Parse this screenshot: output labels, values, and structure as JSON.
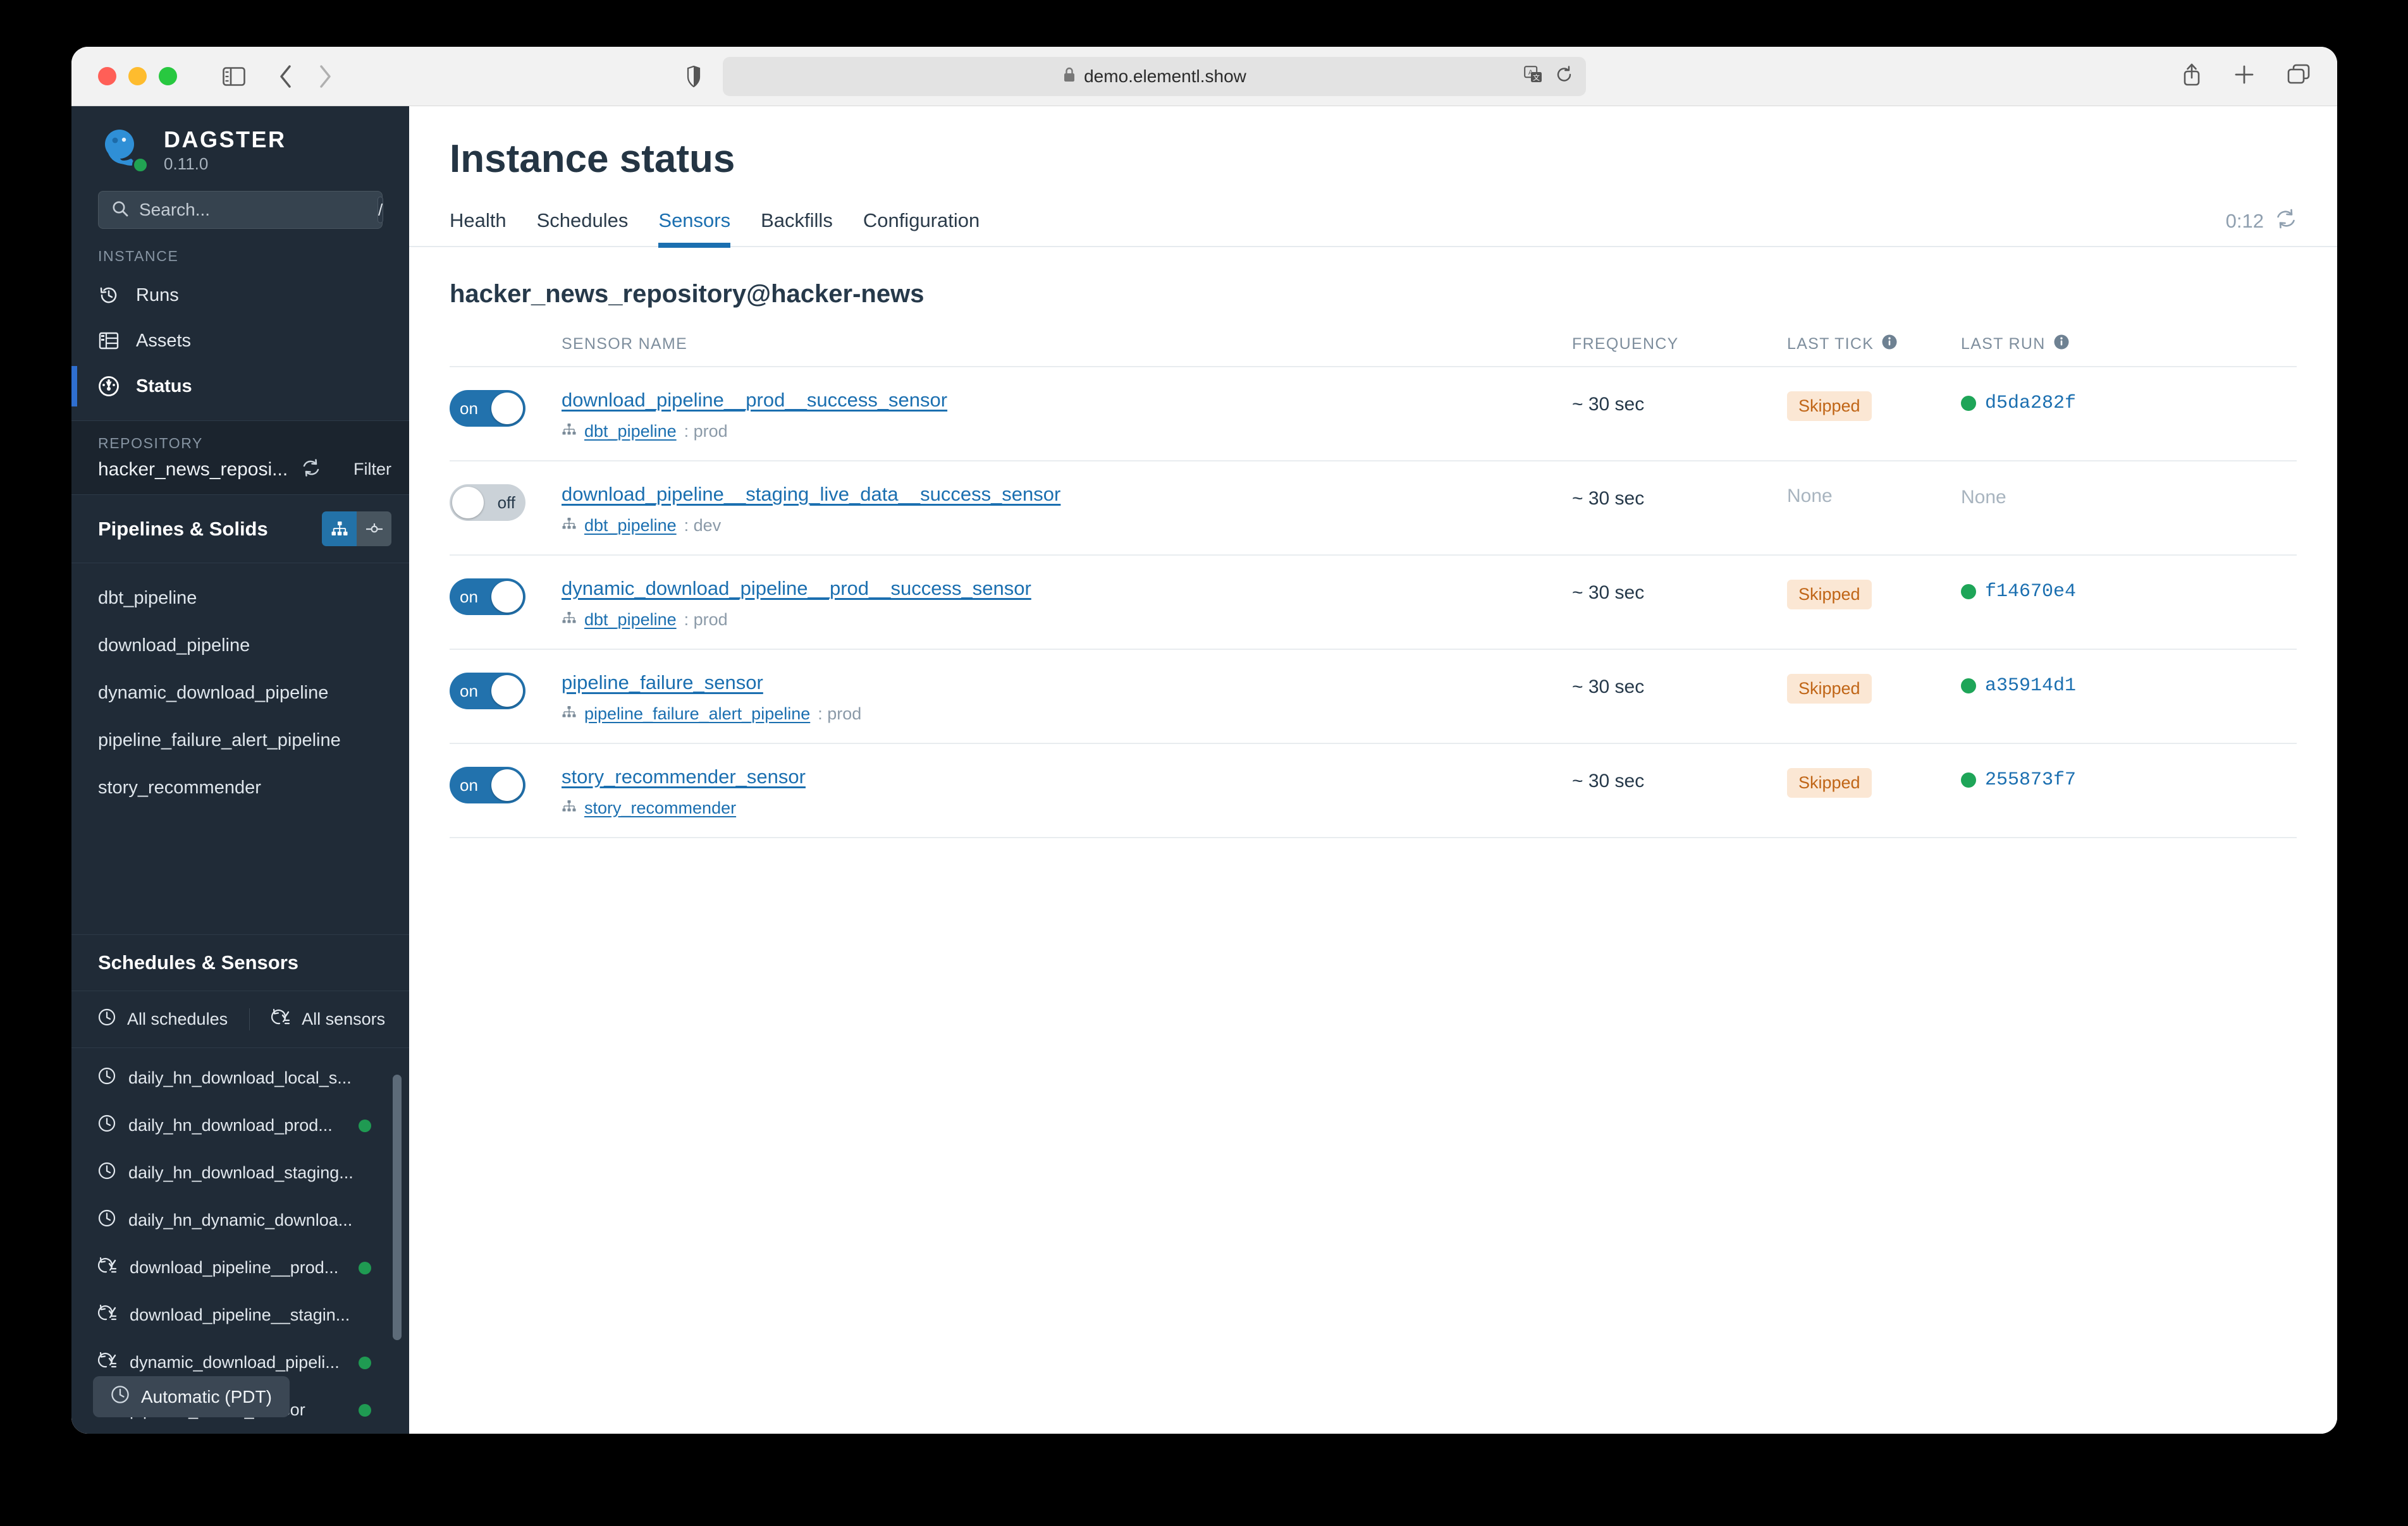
{
  "browser": {
    "url": "demo.elementl.show",
    "icons": {
      "sidebar_toggle": "sidebar-toggle-icon",
      "back": "chevron-left-icon",
      "forward": "chevron-right-icon",
      "shield": "shield-icon",
      "lock": "lock-icon",
      "translate": "translate-icon",
      "reload": "reload-icon",
      "share": "share-icon",
      "new_tab": "plus-icon",
      "tab_overview": "tab-overview-icon"
    }
  },
  "sidebar": {
    "brand": {
      "name": "DAGSTER",
      "version": "0.11.0"
    },
    "search": {
      "value": "",
      "placeholder": "Search...",
      "shortcut": "/"
    },
    "instance_label": "INSTANCE",
    "instance_items": [
      {
        "label": "Runs",
        "icon": "history-icon",
        "active": false
      },
      {
        "label": "Assets",
        "icon": "table-icon",
        "active": false
      },
      {
        "label": "Status",
        "icon": "gauge-icon",
        "active": true
      }
    ],
    "repository": {
      "label": "REPOSITORY",
      "name": "hacker_news_reposi...",
      "reload_icon": "reload-icon",
      "filter_label": "Filter"
    },
    "pipelines": {
      "title": "Pipelines & Solids",
      "view_graph_icon": "hierarchy-icon",
      "view_solid_icon": "node-icon",
      "items": [
        "dbt_pipeline",
        "download_pipeline",
        "dynamic_download_pipeline",
        "pipeline_failure_alert_pipeline",
        "story_recommender"
      ]
    },
    "schedules_sensors": {
      "title": "Schedules & Sensors",
      "tabs": [
        {
          "label": "All schedules",
          "icon": "clock-icon"
        },
        {
          "label": "All sensors",
          "icon": "sensor-icon"
        }
      ],
      "items": [
        {
          "label": "daily_hn_download_local_s...",
          "icon": "clock-icon",
          "status": false
        },
        {
          "label": "daily_hn_download_prod...",
          "icon": "clock-icon",
          "status": true
        },
        {
          "label": "daily_hn_download_staging...",
          "icon": "clock-icon",
          "status": false
        },
        {
          "label": "daily_hn_dynamic_downloa...",
          "icon": "clock-icon",
          "status": false
        },
        {
          "label": "download_pipeline__prod...",
          "icon": "sensor-icon",
          "status": true
        },
        {
          "label": "download_pipeline__stagin...",
          "icon": "sensor-icon",
          "status": false
        },
        {
          "label": "dynamic_download_pipeli...",
          "icon": "sensor-icon",
          "status": true
        },
        {
          "label": "pipeline_failure_sensor",
          "icon": "sensor-icon",
          "status": true
        }
      ]
    },
    "timezone": {
      "label": "Automatic (PDT)",
      "icon": "clock-icon"
    }
  },
  "main": {
    "page_title": "Instance status",
    "tabs": [
      {
        "label": "Health",
        "active": false
      },
      {
        "label": "Schedules",
        "active": false
      },
      {
        "label": "Sensors",
        "active": true
      },
      {
        "label": "Backfills",
        "active": false
      },
      {
        "label": "Configuration",
        "active": false
      }
    ],
    "refresh": {
      "countdown": "0:12",
      "icon": "refresh-icon"
    },
    "repo_heading": "hacker_news_repository@hacker-news",
    "table": {
      "headers": {
        "name": "SENSOR NAME",
        "frequency": "FREQUENCY",
        "last_tick": "LAST TICK",
        "last_run": "LAST RUN",
        "info_icon": "info-icon"
      },
      "rows": [
        {
          "toggle": "on",
          "name": "download_pipeline__prod__success_sensor",
          "pipeline": "dbt_pipeline",
          "mode": "prod",
          "frequency": "~ 30 sec",
          "last_tick": "Skipped",
          "last_tick_type": "badge",
          "last_run": "d5da282f",
          "last_run_type": "run"
        },
        {
          "toggle": "off",
          "name": "download_pipeline__staging_live_data__success_sensor",
          "pipeline": "dbt_pipeline",
          "mode": "dev",
          "frequency": "~ 30 sec",
          "last_tick": "None",
          "last_tick_type": "none",
          "last_run": "None",
          "last_run_type": "none"
        },
        {
          "toggle": "on",
          "name": "dynamic_download_pipeline__prod__success_sensor",
          "pipeline": "dbt_pipeline",
          "mode": "prod",
          "frequency": "~ 30 sec",
          "last_tick": "Skipped",
          "last_tick_type": "badge",
          "last_run": "f14670e4",
          "last_run_type": "run"
        },
        {
          "toggle": "on",
          "name": "pipeline_failure_sensor",
          "pipeline": "pipeline_failure_alert_pipeline",
          "mode": "prod",
          "frequency": "~ 30 sec",
          "last_tick": "Skipped",
          "last_tick_type": "badge",
          "last_run": "a35914d1",
          "last_run_type": "run"
        },
        {
          "toggle": "on",
          "name": "story_recommender_sensor",
          "pipeline": "story_recommender",
          "mode": "",
          "frequency": "~ 30 sec",
          "last_tick": "Skipped",
          "last_tick_type": "badge",
          "last_run": "255873f7",
          "last_run_type": "run"
        }
      ]
    }
  },
  "colors": {
    "accent_blue": "#1b6fb0",
    "toggle_on": "#2272ad",
    "sidebar_bg": "#202b37",
    "status_green": "#1ea558",
    "badge_bg": "#fbe7d4",
    "badge_text": "#c06516"
  }
}
